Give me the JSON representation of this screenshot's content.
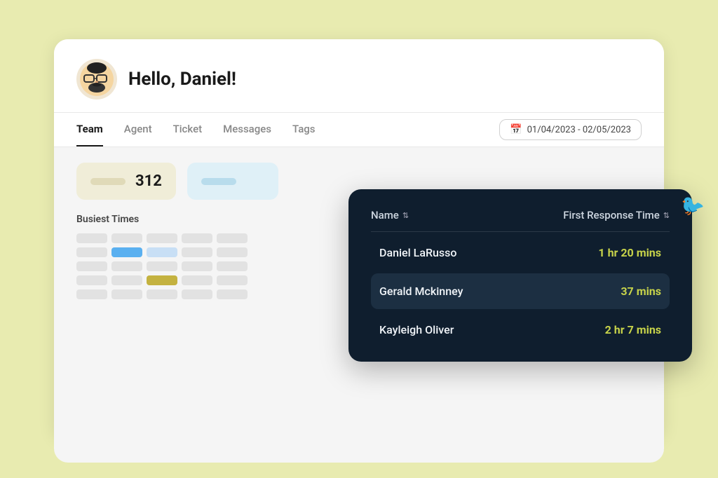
{
  "outer": {
    "background": "#e8ebb0"
  },
  "header": {
    "greeting": "Hello, Daniel!",
    "avatar_emoji": "🧔"
  },
  "nav": {
    "tabs": [
      {
        "label": "Team",
        "active": true
      },
      {
        "label": "Agent",
        "active": false
      },
      {
        "label": "Ticket",
        "active": false
      },
      {
        "label": "Messages",
        "active": false
      },
      {
        "label": "Tags",
        "active": false
      }
    ],
    "date_range": "01/04/2023 - 02/05/2023"
  },
  "stats": [
    {
      "value": "312",
      "type": "yellow"
    },
    {
      "value": "",
      "type": "blue"
    }
  ],
  "busiest_times": {
    "label": "Busiest Times"
  },
  "popup": {
    "columns": [
      {
        "label": "Name",
        "sort": true
      },
      {
        "label": "First Response Time",
        "sort": true
      }
    ],
    "rows": [
      {
        "name": "Daniel LaRusso",
        "time": "1 hr 20 mins",
        "highlighted": false
      },
      {
        "name": "Gerald Mckinney",
        "time": "37 mins",
        "highlighted": true
      },
      {
        "name": "Kayleigh Oliver",
        "time": "2 hr 7 mins",
        "highlighted": false
      }
    ]
  }
}
